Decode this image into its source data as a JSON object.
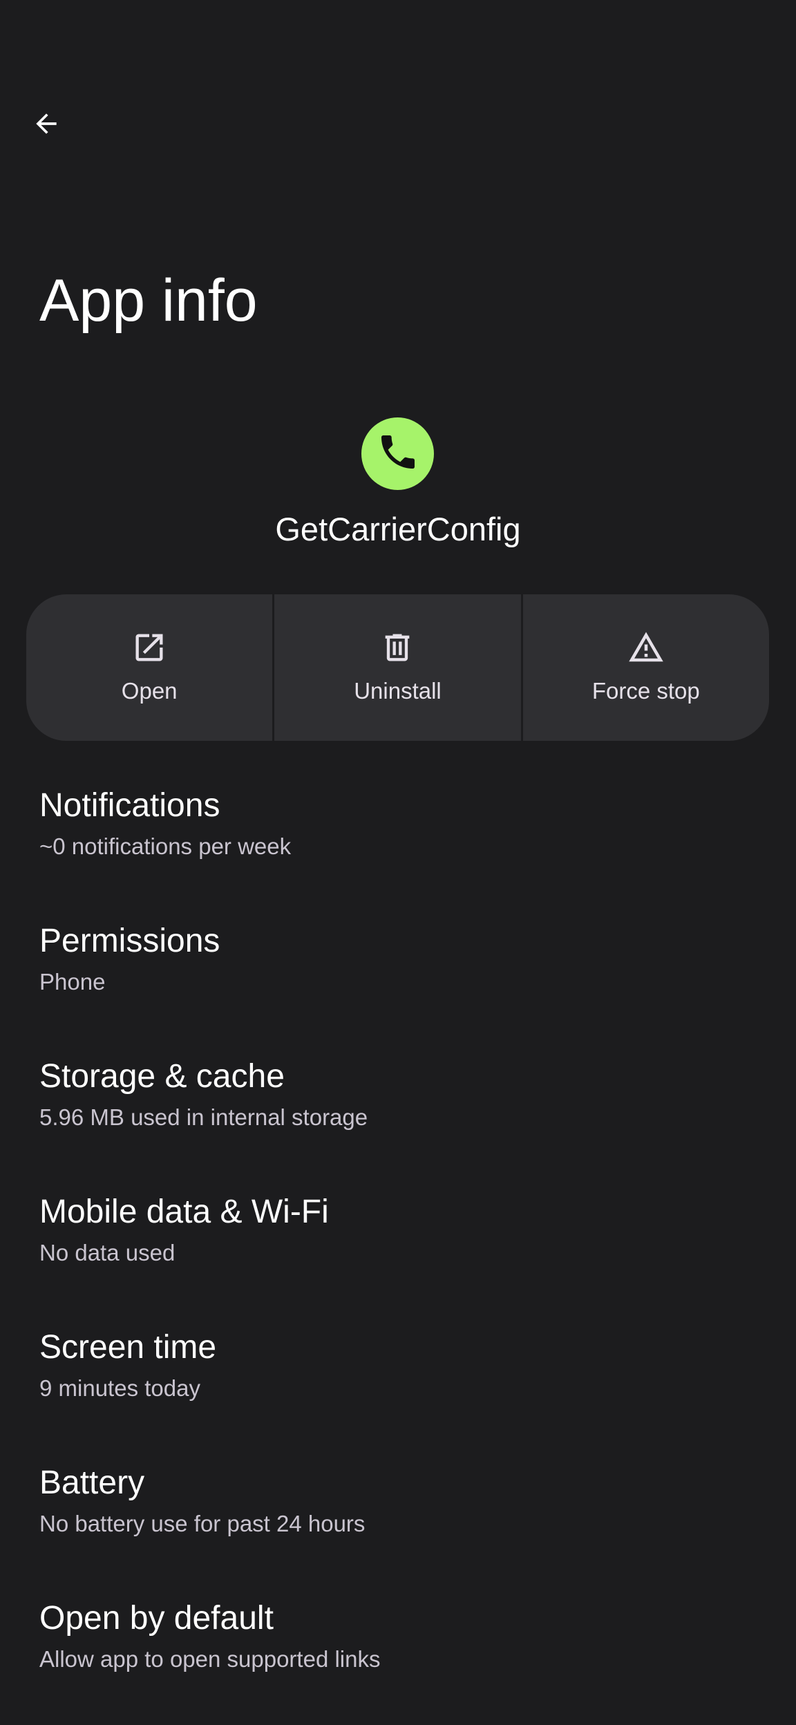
{
  "colors": {
    "background": "#1c1c1e",
    "button_surface": "#2f2f32",
    "app_icon_accent": "#a6f36a"
  },
  "header": {
    "back_icon": "arrow-left-icon",
    "title": "App info"
  },
  "app": {
    "icon": "phone-icon",
    "name": "GetCarrierConfig"
  },
  "actions": [
    {
      "icon": "open-external-icon",
      "label": "Open"
    },
    {
      "icon": "trash-icon",
      "label": "Uninstall"
    },
    {
      "icon": "warning-icon",
      "label": "Force stop"
    }
  ],
  "settings": {
    "items": [
      {
        "title": "Notifications",
        "subtitle": "~0 notifications per week"
      },
      {
        "title": "Permissions",
        "subtitle": "Phone"
      },
      {
        "title": "Storage & cache",
        "subtitle": "5.96 MB used in internal storage"
      },
      {
        "title": "Mobile data & Wi-Fi",
        "subtitle": "No data used"
      },
      {
        "title": "Screen time",
        "subtitle": "9 minutes today"
      },
      {
        "title": "Battery",
        "subtitle": "No battery use for past 24 hours"
      },
      {
        "title": "Open by default",
        "subtitle": "Allow app to open supported links"
      }
    ]
  }
}
